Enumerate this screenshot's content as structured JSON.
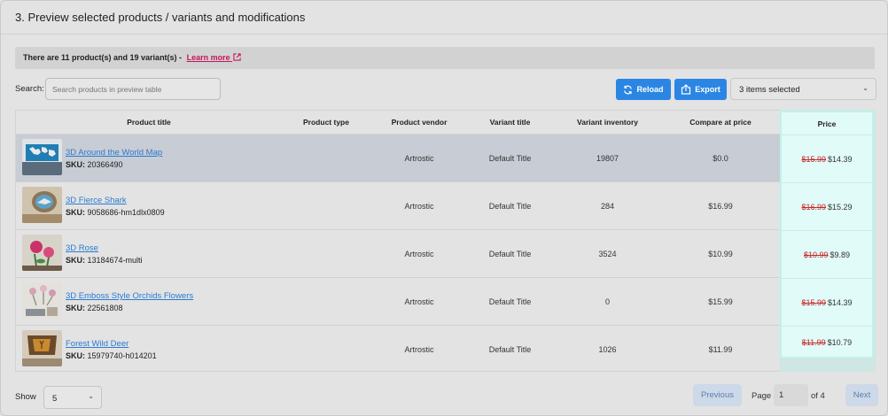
{
  "header": {
    "title": "3. Preview selected products / variants and modifications"
  },
  "notice": {
    "text": "There are 11 product(s) and 19 variant(s) -",
    "link": "Learn more"
  },
  "search": {
    "label": "Search:",
    "placeholder": "Search products in preview table"
  },
  "toolbar": {
    "reload_label": "Reload",
    "export_label": "Export",
    "selected_label": "3 items selected"
  },
  "table": {
    "headers": [
      "Product title",
      "Product type",
      "Product vendor",
      "Variant title",
      "Variant inventory",
      "Compare at price",
      "Price"
    ],
    "rows": [
      {
        "title": "3D Around the World Map",
        "sku_label": "SKU:",
        "sku": "20366490",
        "type": "",
        "vendor": "Artrostic",
        "variant": "Default Title",
        "inventory": "19807",
        "compare": "$0.0",
        "old_price": "$15.99",
        "price": "$14.39"
      },
      {
        "title": "3D Fierce Shark",
        "sku_label": "SKU:",
        "sku": "9058686-hm1dlx0809",
        "type": "",
        "vendor": "Artrostic",
        "variant": "Default Title",
        "inventory": "284",
        "compare": "$16.99",
        "old_price": "$16.99",
        "price": "$15.29"
      },
      {
        "title": "3D Rose",
        "sku_label": "SKU:",
        "sku": "13184674-multi",
        "type": "",
        "vendor": "Artrostic",
        "variant": "Default Title",
        "inventory": "3524",
        "compare": "$10.99",
        "old_price": "$10.99",
        "price": "$9.89"
      },
      {
        "title": "3D Emboss Style Orchids Flowers",
        "sku_label": "SKU:",
        "sku": "22561808",
        "type": "",
        "vendor": "Artrostic",
        "variant": "Default Title",
        "inventory": "0",
        "compare": "$15.99",
        "old_price": "$15.99",
        "price": "$14.39"
      },
      {
        "title": "Forest Wild Deer",
        "sku_label": "SKU:",
        "sku": "15979740-h014201",
        "type": "",
        "vendor": "Artrostic",
        "variant": "Default Title",
        "inventory": "1026",
        "compare": "$11.99",
        "old_price": "$11.99",
        "price": "$10.79"
      }
    ]
  },
  "pagination": {
    "show_label": "Show",
    "page_size": "5",
    "previous": "Previous",
    "page_label": "Page",
    "page": "1",
    "of_label": "of 4",
    "next": "Next"
  },
  "colors": {
    "accent": "#2b86e3",
    "link": "#2b7bd1",
    "learn_more": "#c4165c",
    "strike": "#c62828",
    "price_highlight": "#e1fbf8"
  },
  "icons": [
    "external-link-icon",
    "refresh-icon",
    "export-icon",
    "chevron-down-icon"
  ]
}
